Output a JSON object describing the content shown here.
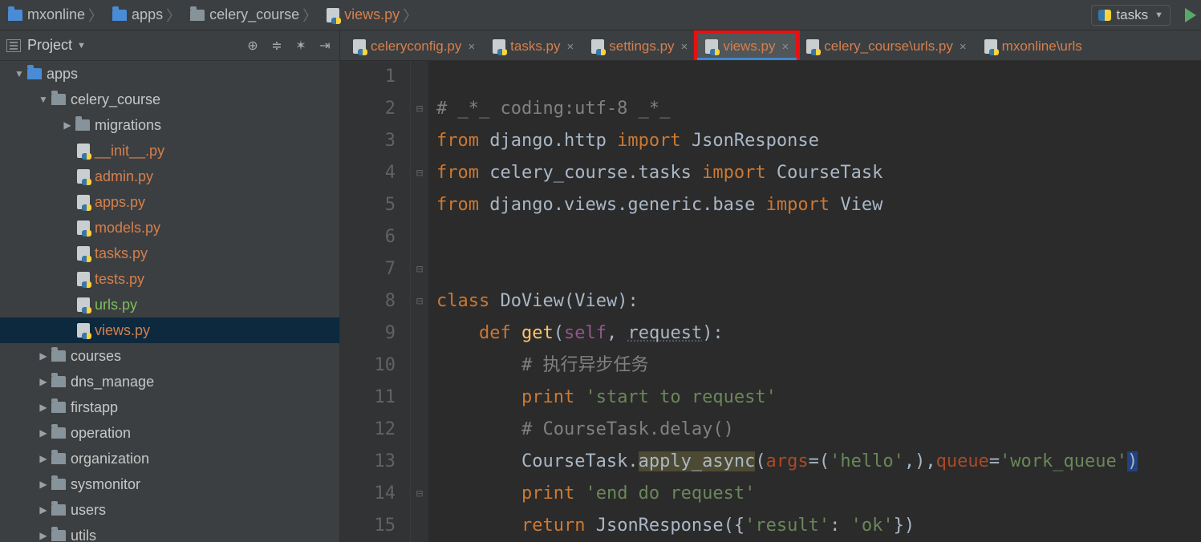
{
  "run_config": {
    "label": "tasks"
  },
  "breadcrumbs": [
    {
      "label": "mxonline",
      "icon": "folder-blue"
    },
    {
      "label": "apps",
      "icon": "folder-blue"
    },
    {
      "label": "celery_course",
      "icon": "folder"
    },
    {
      "label": "views.py",
      "icon": "pyfile",
      "highlight": true
    }
  ],
  "sidebar": {
    "title": "Project",
    "tree": {
      "apps": {
        "celery_course": {
          "migrations": {},
          "files": [
            {
              "name": "__init__.py",
              "style": "orange"
            },
            {
              "name": "admin.py",
              "style": "orange"
            },
            {
              "name": "apps.py",
              "style": "orange"
            },
            {
              "name": "models.py",
              "style": "orange"
            },
            {
              "name": "tasks.py",
              "style": "orange"
            },
            {
              "name": "tests.py",
              "style": "orange"
            },
            {
              "name": "urls.py",
              "style": "green"
            },
            {
              "name": "views.py",
              "style": "orange",
              "selected": true
            }
          ]
        },
        "folders": [
          "courses",
          "dns_manage",
          "firstapp",
          "operation",
          "organization",
          "sysmonitor",
          "users",
          "utils"
        ]
      }
    }
  },
  "tabs": [
    {
      "name": "celeryconfig.py"
    },
    {
      "name": "tasks.py"
    },
    {
      "name": "settings.py"
    },
    {
      "name": "views.py",
      "active": true,
      "highlight": true
    },
    {
      "name": "celery_course\\urls.py"
    },
    {
      "name": "mxonline\\urls"
    }
  ],
  "editor": {
    "line_numbers": [
      "1",
      "2",
      "3",
      "4",
      "5",
      "6",
      "7",
      "8",
      "9",
      "10",
      "11",
      "12",
      "13",
      "14",
      "15"
    ],
    "fold_marks": [
      "",
      "⊟",
      "",
      "⊟",
      "",
      "",
      "⊟",
      "⊟",
      "",
      "",
      "",
      "",
      "",
      "⊟",
      ""
    ]
  },
  "code": {
    "l1_cmt": "# _*_ coding:utf-8 _*_",
    "l2_kw_from": "from",
    "l2_mod": "django.http",
    "l2_kw_imp": "import",
    "l2_name": "JsonResponse",
    "l3_kw_from": "from",
    "l3_mod": "celery_course.tasks",
    "l3_kw_imp": "import",
    "l3_name": "CourseTask",
    "l4_kw_from": "from",
    "l4_mod": "django.views.generic.base",
    "l4_kw_imp": "import",
    "l4_name": "View",
    "l7_kw": "class",
    "l7_name": "DoView",
    "l7_base": "View",
    "l8_kw": "def",
    "l8_fn": "get",
    "l8_self": "self",
    "l8_req": "request",
    "l9_cmt": "# 执行异步任务",
    "l10_kw": "print",
    "l10_str": "'start to request'",
    "l11_cmt": "# CourseTask.delay()",
    "l12_obj": "CourseTask.",
    "l12_meth": "apply_async",
    "l12_args_kw": "args",
    "l12_args_val": "'hello'",
    "l12_queue_kw": "queue",
    "l12_queue_val": "'work_queue'",
    "l13_kw": "print",
    "l13_str": "'end do request'",
    "l14_kw": "return",
    "l14_fn": "JsonResponse",
    "l14_key": "'result'",
    "l14_val": "'ok'"
  }
}
